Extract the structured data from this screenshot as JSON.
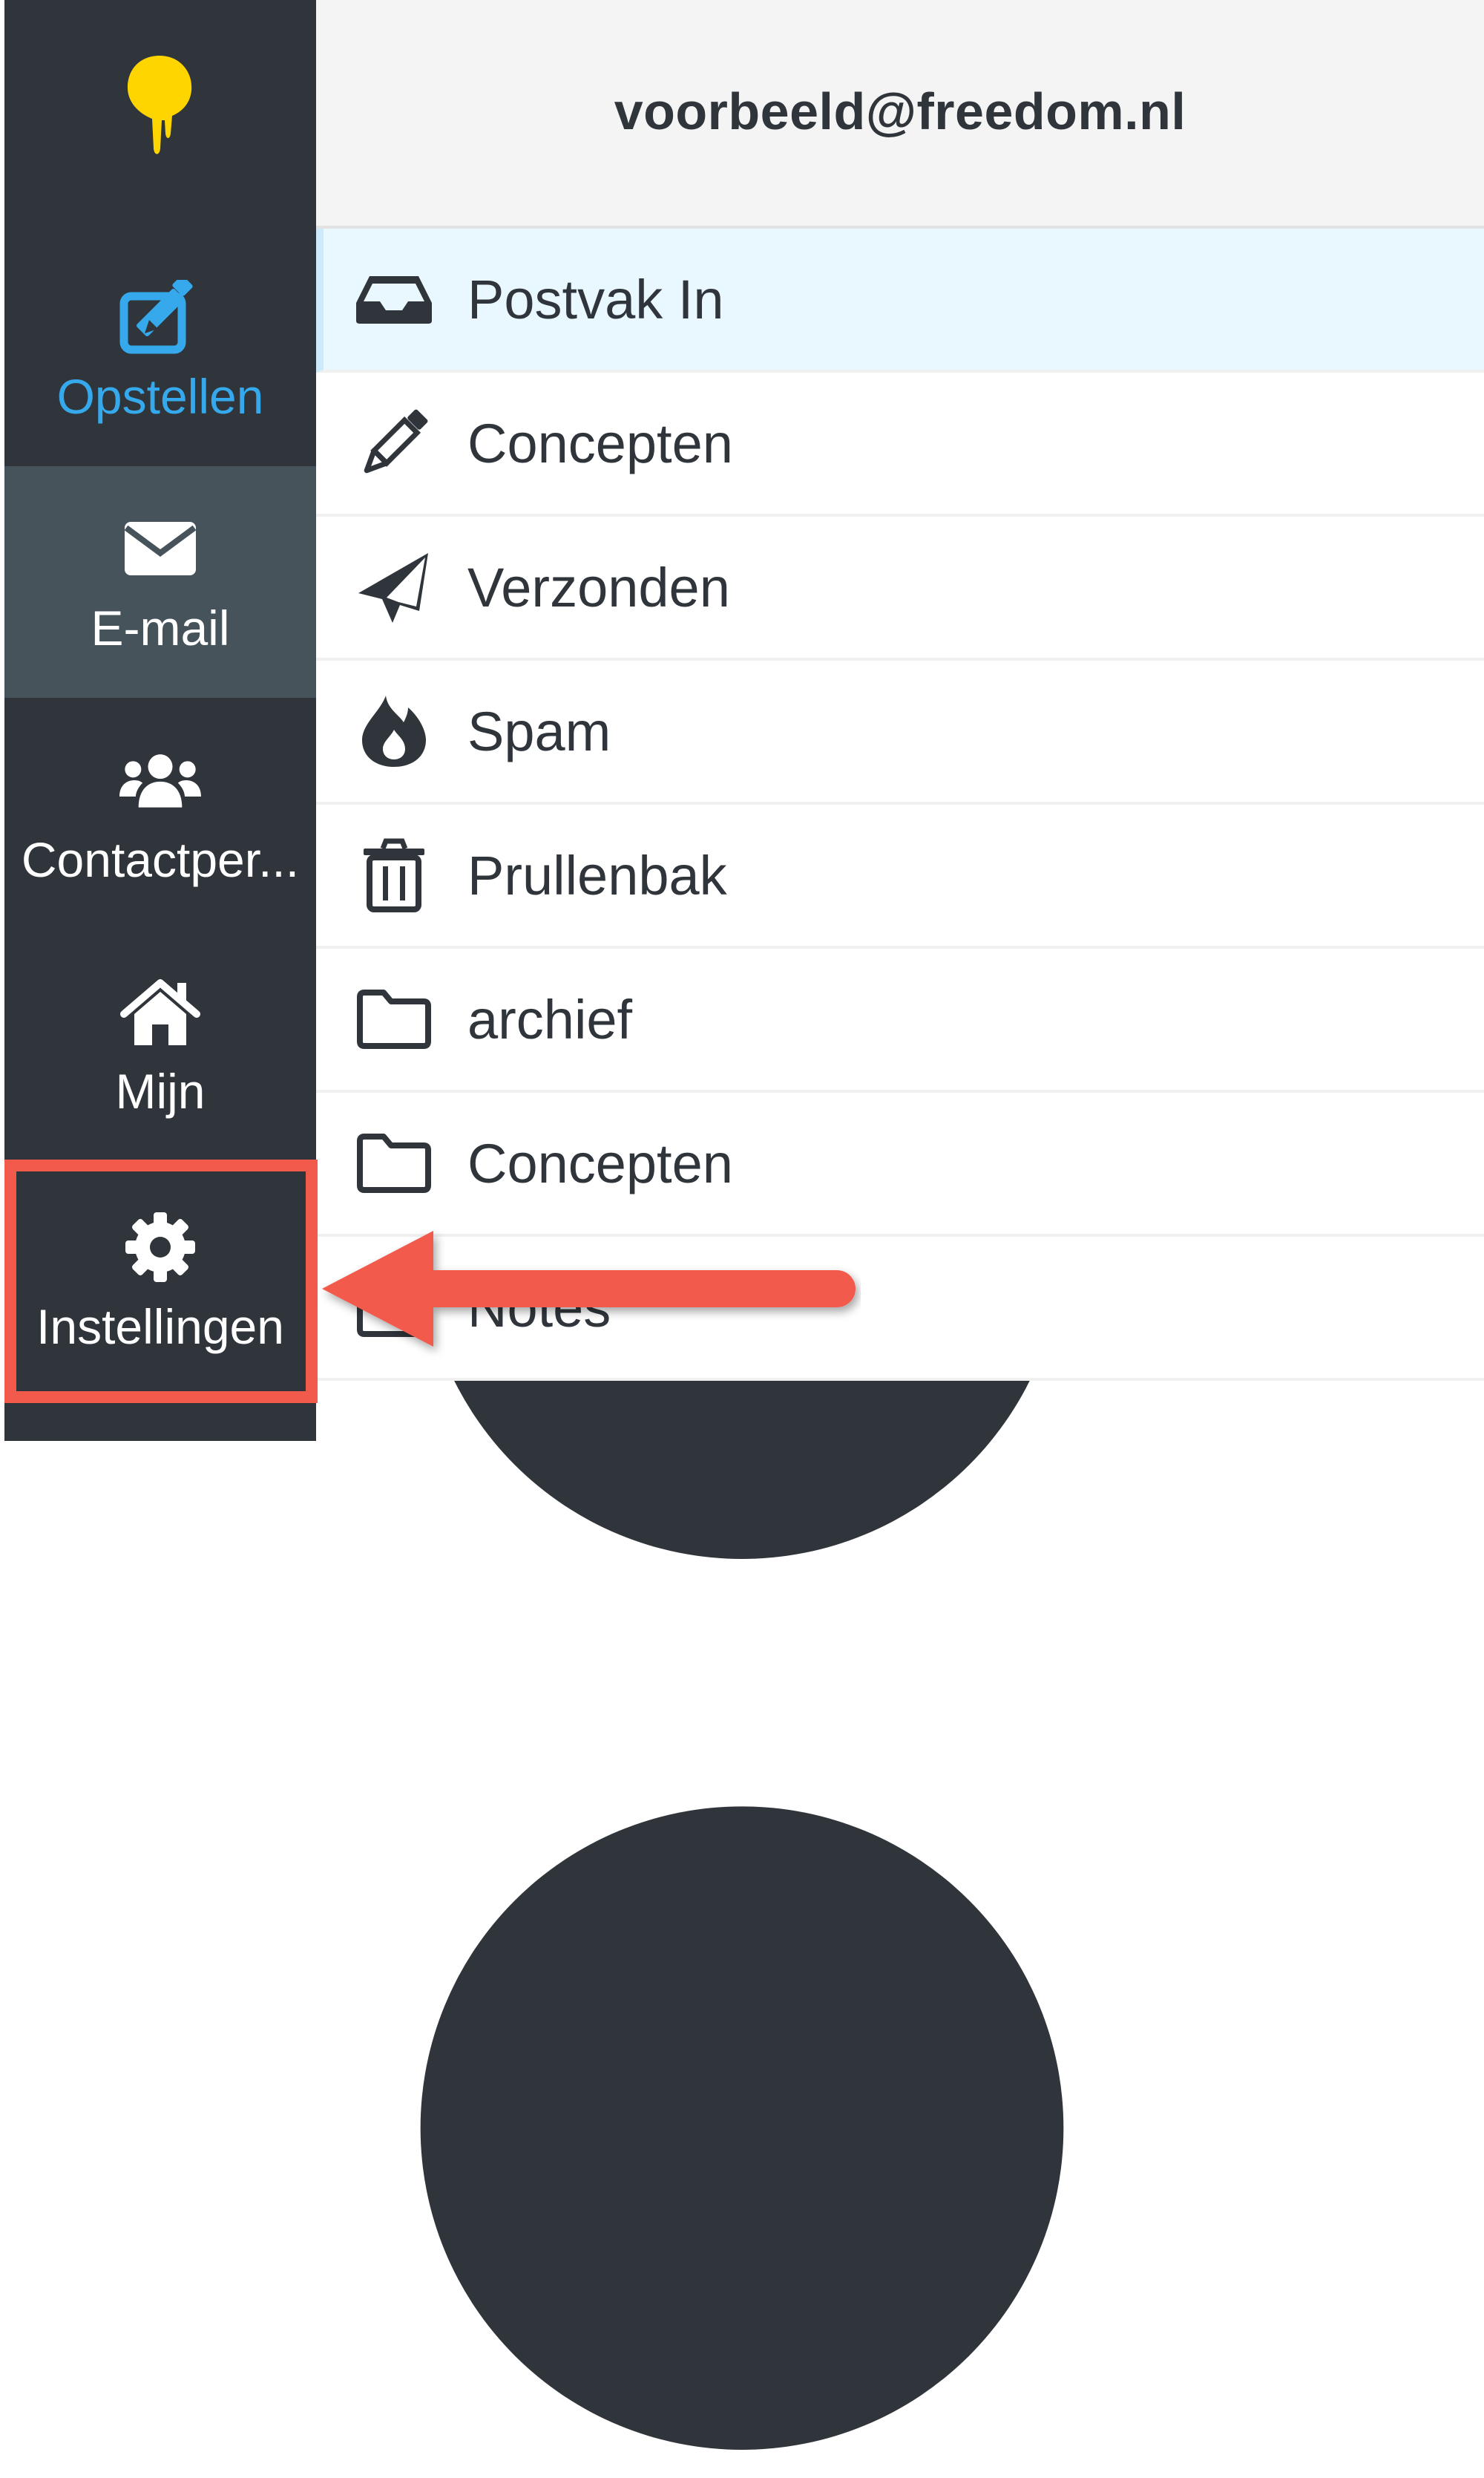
{
  "account": "voorbeeld@freedom.nl",
  "sidebar": {
    "items": [
      {
        "label": "Opstellen",
        "icon": "compose-icon"
      },
      {
        "label": "E-mail",
        "icon": "envelope-icon"
      },
      {
        "label": "Contactper...",
        "icon": "users-icon"
      },
      {
        "label": "Mijn",
        "icon": "home-icon"
      },
      {
        "label": "Instellingen",
        "icon": "gear-icon"
      }
    ]
  },
  "folders": [
    {
      "name": "Postvak In",
      "icon": "inbox-icon"
    },
    {
      "name": "Concepten",
      "icon": "pencil-icon"
    },
    {
      "name": "Verzonden",
      "icon": "paper-plane-icon"
    },
    {
      "name": "Spam",
      "icon": "fire-icon"
    },
    {
      "name": "Prullenbak",
      "icon": "trash-icon"
    },
    {
      "name": "archief",
      "icon": "folder-icon"
    },
    {
      "name": "Concepten",
      "icon": "folder-icon"
    },
    {
      "name": "Notes",
      "icon": "folder-icon"
    }
  ],
  "colors": {
    "sidebar_bg": "#2f353b",
    "active_nav_bg": "#47535b",
    "accent_blue": "#35a9ec",
    "logo_yellow": "#ffd500",
    "selected_folder_bg": "#e9f7fe",
    "callout_red": "#f25a4c"
  }
}
